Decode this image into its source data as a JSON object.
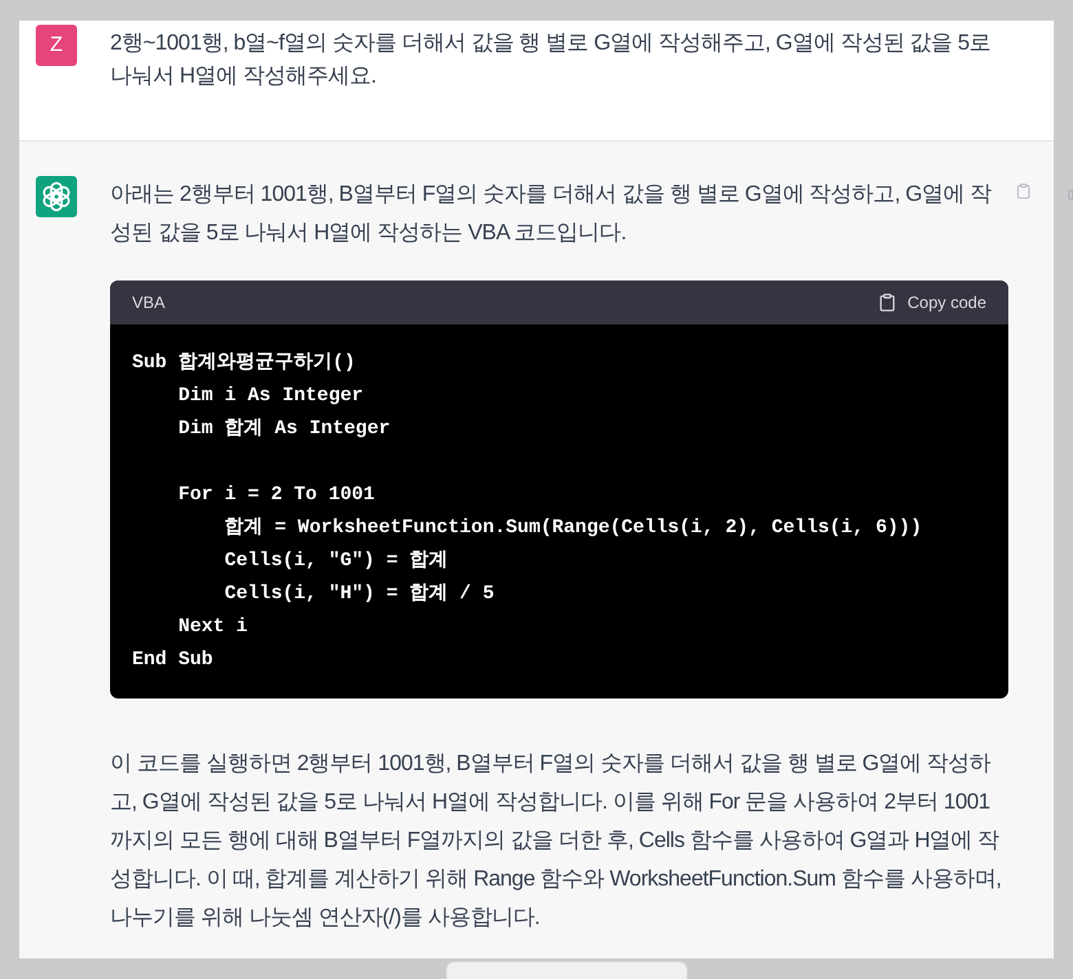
{
  "user_message": {
    "avatar": "Z",
    "text": "2행~1001행, b열~f열의 숫자를 더해서 값을 행 별로 G열에 작성해주고, G열에 작성된 값을 5로 나눠서 H열에 작성해주세요."
  },
  "assistant_message": {
    "intro": "아래는 2행부터 1001행, B열부터 F열의 숫자를 더해서 값을 행 별로 G열에 작성하고, G열에 작성된 값을 5로 나눠서 H열에 작성하는 VBA 코드입니다.",
    "code_block": {
      "language": "VBA",
      "copy_label": "Copy code",
      "code": "Sub 합계와평균구하기()\n    Dim i As Integer\n    Dim 합계 As Integer\n\n    For i = 2 To 1001\n        합계 = WorksheetFunction.Sum(Range(Cells(i, 2), Cells(i, 6)))\n        Cells(i, \"G\") = 합계\n        Cells(i, \"H\") = 합계 / 5\n    Next i\nEnd Sub"
    },
    "explanation": "이 코드를 실행하면 2행부터 1001행, B열부터 F열의 숫자를 더해서 값을 행 별로 G열에 작성하고, G열에 작성된 값을 5로 나눠서 H열에 작성합니다. 이를 위해 For 문을 사용하여 2부터 1001까지의 모든 행에 대해 B열부터 F열까지의 값을 더한 후, Cells 함수를 사용하여 G열과 H열에 작성합니다. 이 때, 합계를 계산하기 위해 Range 함수와 WorksheetFunction.Sum 함수를 사용하며, 나누기를 위해 나눗셈 연산자(/)를 사용합니다."
  }
}
